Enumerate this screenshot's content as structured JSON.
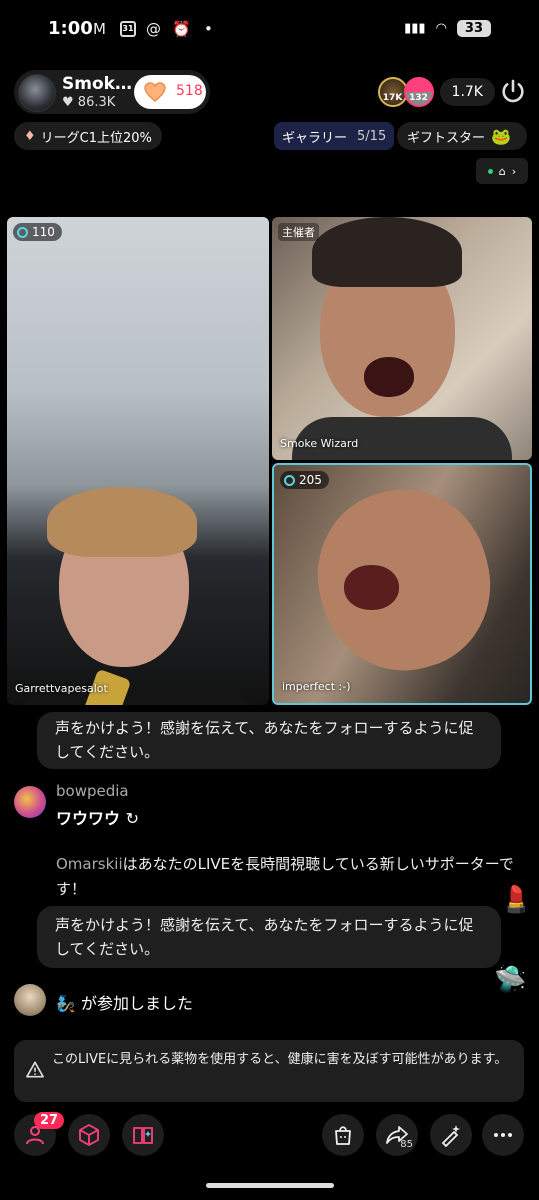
{
  "status_bar": {
    "time": "1:00",
    "battery": "33",
    "calendar": "31"
  },
  "host": {
    "name": "Smok…",
    "likes": "86.3K",
    "follow_count": "518"
  },
  "viewers": {
    "avatar1_level": "17K",
    "avatar2_level": "132",
    "count": "1.7K"
  },
  "league": "リーグC1上位20%",
  "gallery": {
    "label": "ギャラリー",
    "count": "5/15"
  },
  "gift_star": "ギフトスター",
  "tiles": {
    "main": {
      "badge": "110",
      "name": "Garrettvapesalot"
    },
    "host": {
      "tag": "主催者",
      "name": "Smoke Wizard"
    },
    "guest": {
      "badge": "205",
      "name": "imperfect :-)"
    }
  },
  "chat": {
    "bubble1": "声をかけよう！感謝を伝えて、あなたをフォローするように促してください。",
    "user1": "bowpedia",
    "msg1": "ワウワウ",
    "system_name": "Omarskii",
    "system_text": "はあなたのLIVEを長時間視聴している新しいサポーターです！",
    "bubble2": "声をかけよう！感謝を伝えて、あなたをフォローするように促してください。",
    "joined": "が参加しました"
  },
  "warning": "このLIVEに見られる薬物を使用すると、健康に害を及ぼす可能性があります。",
  "toolbar": {
    "guests_badge": "27",
    "share_count": "85"
  },
  "colors": {
    "accent": "#ff2b55",
    "guest_border": "#5fc8d8",
    "gallery_bg": "#1c2347"
  }
}
